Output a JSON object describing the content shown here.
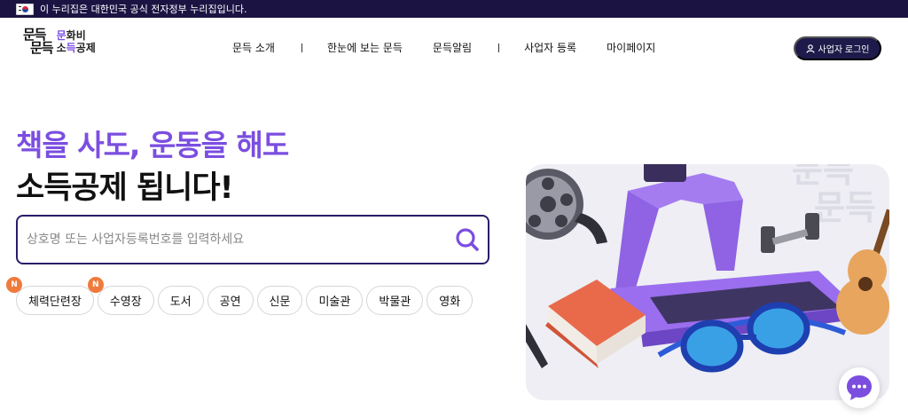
{
  "gov_banner": {
    "text": "이 누리집은 대한민국 공식 전자정부 누리집입니다.",
    "flag_icon": "korea-flag-icon"
  },
  "logo": {
    "mark_line1": "문득",
    "mark_line2": "문득",
    "text_line1": "문화비",
    "text_line2": "소득공제",
    "accent": "#7b4ee0"
  },
  "nav": {
    "items": [
      "문득 소개",
      "한눈에 보는 문득",
      "문득알림",
      "사업자 등록",
      "마이페이지"
    ]
  },
  "login": {
    "label": "사업자 로그인",
    "icon": "user-icon",
    "bg": "#1e1a4a"
  },
  "hero": {
    "line1": "책을 사도, 운동을 해도",
    "line2": "소득공제 됩니다!",
    "accent": "#7b4ee0"
  },
  "search": {
    "placeholder": "상호명 또는 사업자등록번호를 입력하세요",
    "value": "",
    "icon": "search-icon"
  },
  "categories": [
    {
      "label": "체력단련장",
      "badge": "N"
    },
    {
      "label": "수영장",
      "badge": "N"
    },
    {
      "label": "도서",
      "badge": ""
    },
    {
      "label": "공연",
      "badge": ""
    },
    {
      "label": "신문",
      "badge": ""
    },
    {
      "label": "미술관",
      "badge": ""
    },
    {
      "label": "박물관",
      "badge": ""
    },
    {
      "label": "영화",
      "badge": ""
    }
  ],
  "illustration": {
    "watermark_line1": "문득",
    "watermark_line2": "문득",
    "objects": [
      "treadmill",
      "film-reel",
      "dumbbell",
      "guitar",
      "book",
      "swim-goggles"
    ]
  },
  "chat_button": {
    "icon": "chat-bubble-icon",
    "color": "#7b4ee0"
  }
}
